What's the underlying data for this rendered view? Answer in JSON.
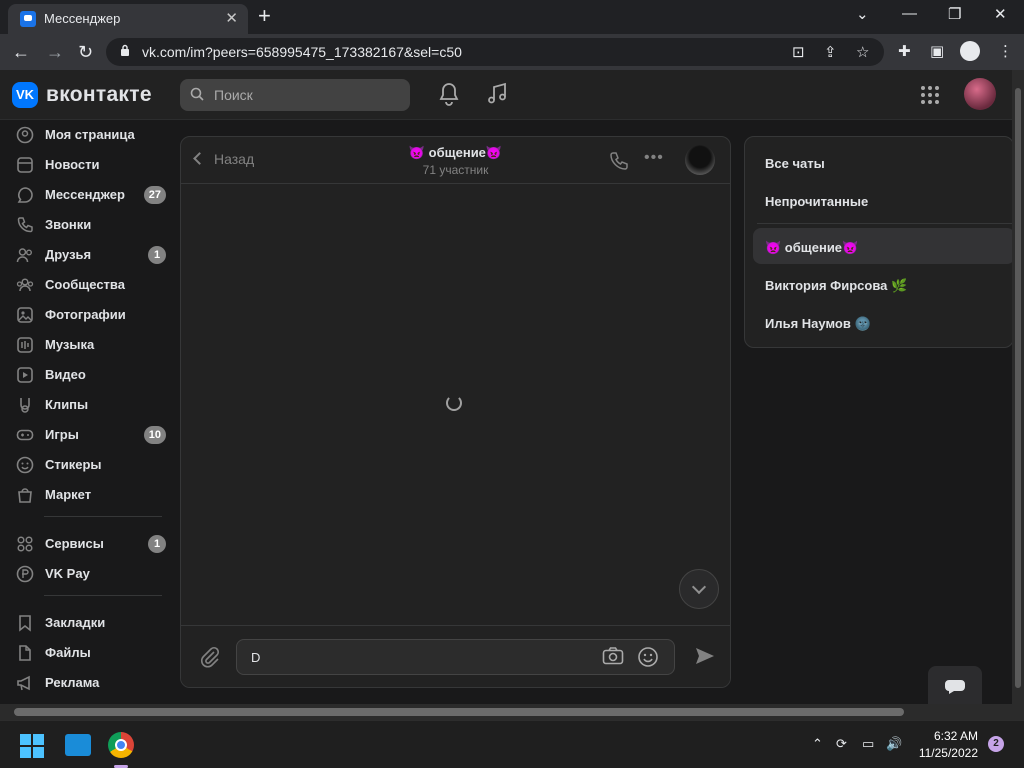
{
  "browser": {
    "tab_title": "Мессенджер",
    "tab_close": "✕",
    "new_tab": "+",
    "url": "vk.com/im?peers=658995475_173382167&sel=c50"
  },
  "header": {
    "logo_mark": "VK",
    "logo_text": "вконтакте",
    "search_placeholder": "Поиск"
  },
  "sidebar": {
    "items": [
      {
        "label": "Моя страница",
        "icon": "user-circle-icon",
        "badge": ""
      },
      {
        "label": "Новости",
        "icon": "news-icon",
        "badge": ""
      },
      {
        "label": "Мессенджер",
        "icon": "message-icon",
        "badge": "27"
      },
      {
        "label": "Звонки",
        "icon": "phone-icon",
        "badge": ""
      },
      {
        "label": "Друзья",
        "icon": "friends-icon",
        "badge": "1"
      },
      {
        "label": "Сообщества",
        "icon": "communities-icon",
        "badge": ""
      },
      {
        "label": "Фотографии",
        "icon": "photo-icon",
        "badge": ""
      },
      {
        "label": "Музыка",
        "icon": "music-icon",
        "badge": ""
      },
      {
        "label": "Видео",
        "icon": "video-icon",
        "badge": ""
      },
      {
        "label": "Клипы",
        "icon": "clips-icon",
        "badge": ""
      },
      {
        "label": "Игры",
        "icon": "games-icon",
        "badge": "10"
      },
      {
        "label": "Стикеры",
        "icon": "stickers-icon",
        "badge": ""
      },
      {
        "label": "Маркет",
        "icon": "market-icon",
        "badge": ""
      },
      {
        "label": "Сервисы",
        "icon": "services-icon",
        "badge": "1"
      },
      {
        "label": "VK Pay",
        "icon": "vkpay-icon",
        "badge": ""
      },
      {
        "label": "Закладки",
        "icon": "bookmark-icon",
        "badge": ""
      },
      {
        "label": "Файлы",
        "icon": "files-icon",
        "badge": ""
      },
      {
        "label": "Реклама",
        "icon": "ads-icon",
        "badge": ""
      }
    ]
  },
  "chat": {
    "back_label": "Назад",
    "title": "👿 общение👿",
    "subtitle": "71 участник",
    "input_value": "D"
  },
  "chat_list": {
    "filters": [
      "Все чаты",
      "Непрочитанные"
    ],
    "chats": [
      "👿 общение👿",
      "Виктория Фирсова 🌿",
      "Илья Наумов 🌚"
    ]
  },
  "taskbar": {
    "time": "6:32 AM",
    "date": "11/25/2022",
    "notifications": "2"
  },
  "colors": {
    "accent": "#0077ff",
    "background": "#19191a",
    "panel": "#222222",
    "badge": "#828282"
  }
}
